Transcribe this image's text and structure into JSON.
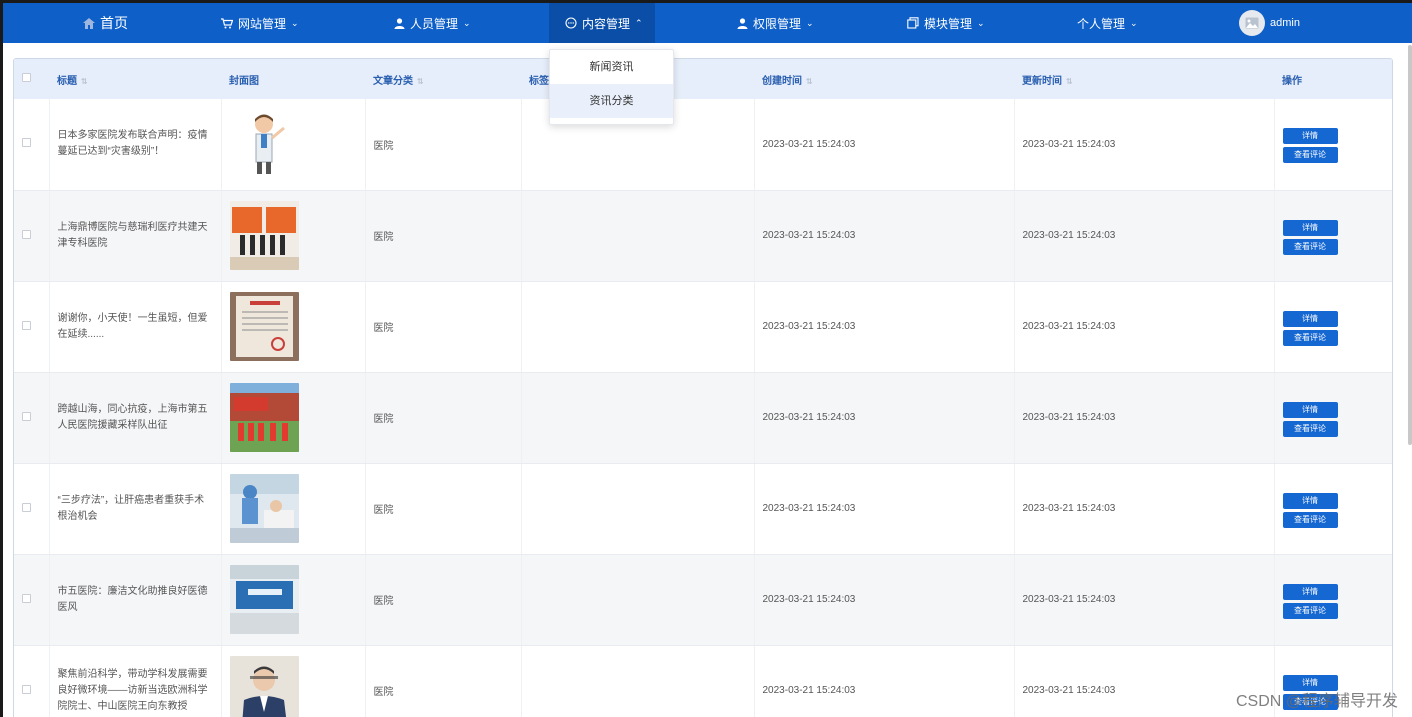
{
  "nav": {
    "home": "首页",
    "items": [
      "网站管理",
      "人员管理",
      "内容管理",
      "权限管理",
      "模块管理",
      "个人管理"
    ],
    "user": "admin"
  },
  "dropdown": {
    "items": [
      "新闻资讯",
      "资讯分类"
    ]
  },
  "table": {
    "headers": {
      "title": "标题",
      "cover": "封面图",
      "category": "文章分类",
      "tags": "标签",
      "created": "创建时间",
      "updated": "更新时间",
      "actions": "操作"
    },
    "rows": [
      {
        "title": "日本多家医院发布联合声明：疫情蔓延已达到“灾害级别”！",
        "category": "医院",
        "created": "2023-03-21 15:24:03",
        "updated": "2023-03-21 15:24:03"
      },
      {
        "title": "上海鼎博医院与慈瑞利医疗共建天津专科医院",
        "category": "医院",
        "created": "2023-03-21 15:24:03",
        "updated": "2023-03-21 15:24:03"
      },
      {
        "title": "谢谢你，小天使！一生虽短，但爱在延续......",
        "category": "医院",
        "created": "2023-03-21 15:24:03",
        "updated": "2023-03-21 15:24:03"
      },
      {
        "title": "跨越山海，同心抗疫，上海市第五人民医院援藏采样队出征",
        "category": "医院",
        "created": "2023-03-21 15:24:03",
        "updated": "2023-03-21 15:24:03"
      },
      {
        "title": "“三步疗法”，让肝癌患者重获手术根治机会",
        "category": "医院",
        "created": "2023-03-21 15:24:03",
        "updated": "2023-03-21 15:24:03"
      },
      {
        "title": "市五医院：廉洁文化助推良好医德医风",
        "category": "医院",
        "created": "2023-03-21 15:24:03",
        "updated": "2023-03-21 15:24:03"
      },
      {
        "title": "聚焦前沿科学，带动学科发展需要良好微环境——访新当选欧洲科学院院士、中山医院王向东教授",
        "category": "医院",
        "created": "2023-03-21 15:24:03",
        "updated": "2023-03-21 15:24:03"
      }
    ],
    "buttons": {
      "detail": "详情",
      "comments": "查看评论"
    }
  },
  "watermark": "CSDN @程序辅导开发",
  "colors": {
    "nav": "#0e5fc8",
    "button": "#1567d2",
    "header_bg": "#e7eefb"
  }
}
